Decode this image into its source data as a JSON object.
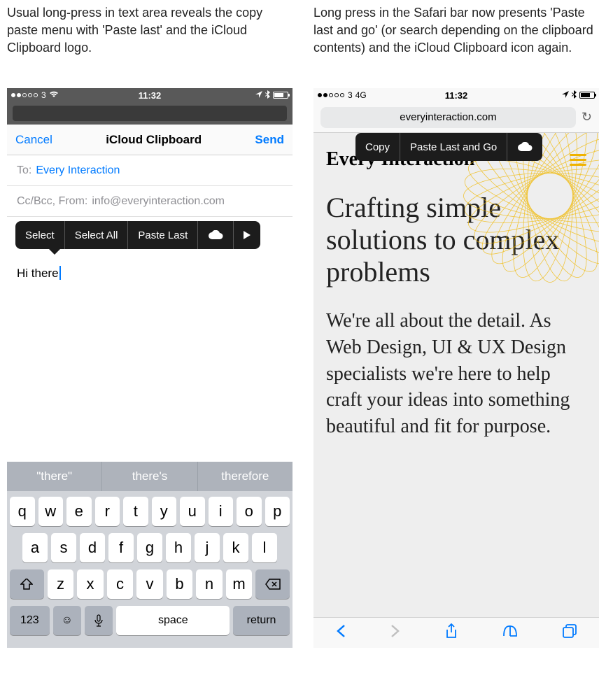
{
  "left": {
    "caption": "Usual long-press in text area reveals the copy paste menu with 'Paste last' and the iCloud Clipboard logo.",
    "status": {
      "carrier": "3",
      "net": "",
      "time": "11:32"
    },
    "nav": {
      "cancel": "Cancel",
      "title": "iCloud Clipboard",
      "send": "Send"
    },
    "to_label": "To:",
    "to_value": "Every Interaction",
    "cc_label": "Cc/Bcc, From:",
    "cc_value": "info@everyinteraction.com",
    "ctx": {
      "select": "Select",
      "select_all": "Select All",
      "paste_last": "Paste Last"
    },
    "body_text": "Hi there",
    "suggestions": {
      "a": "\"there\"",
      "b": "there's",
      "c": "therefore"
    },
    "keys": {
      "row1": [
        "q",
        "w",
        "e",
        "r",
        "t",
        "y",
        "u",
        "i",
        "o",
        "p"
      ],
      "row2": [
        "a",
        "s",
        "d",
        "f",
        "g",
        "h",
        "j",
        "k",
        "l"
      ],
      "row3": [
        "z",
        "x",
        "c",
        "v",
        "b",
        "n",
        "m"
      ],
      "num": "123",
      "space": "space",
      "return": "return"
    }
  },
  "right": {
    "caption": "Long press in the Safari bar now presents 'Paste last and go' (or search depending on the clipboard contents) and the iCloud Clipboard icon again.",
    "status": {
      "carrier": "3",
      "net": "4G",
      "time": "11:32"
    },
    "url": "everyinteraction.com",
    "ctx": {
      "copy": "Copy",
      "paste_go": "Paste Last and Go"
    },
    "logo": "Every Interaction",
    "headline": "Crafting simple solutions to complex problems",
    "subtext": "We're all about the detail. As Web Design, UI & UX Design specialists we're here to help craft your ideas into something beautiful and fit for purpose."
  }
}
